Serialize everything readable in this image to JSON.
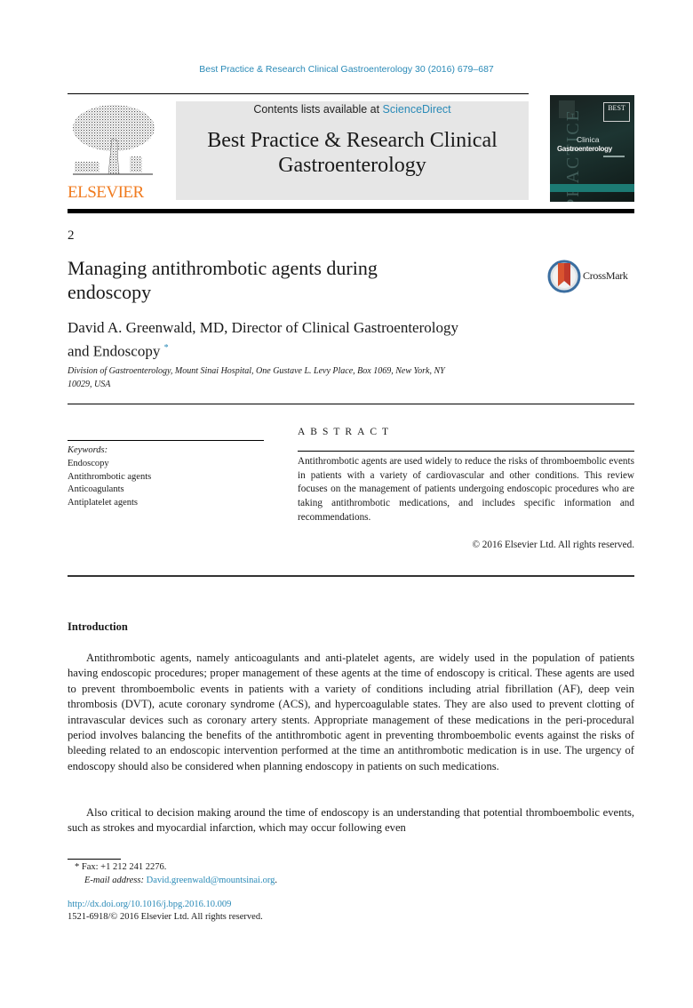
{
  "header": {
    "journal_reference": "Best Practice & Research Clinical Gastroenterology 30 (2016) 679–687",
    "contents_prefix": "Contents lists available at ",
    "contents_link": "ScienceDirect",
    "journal_title_line1": "Best Practice & Research Clinical",
    "journal_title_line2": "Gastroenterology",
    "publisher_logo_text": "ELSEVIER",
    "cover": {
      "badge_text": "BEST",
      "subtitle_line1": "Clinica",
      "subtitle_line2": "Gastroenterology",
      "vertical_text": "PRACTICE"
    },
    "colors": {
      "link": "#2a8ab7",
      "elsevier_orange": "#f07b1f",
      "masthead_bg": "#e6e6e6",
      "cover_stripe": "#1c7a73"
    }
  },
  "article": {
    "number": "2",
    "title_line1": "Managing antithrombotic agents during",
    "title_line2": "endoscopy",
    "crossmark_label": "CrossMark",
    "author_line1": "David A. Greenwald, MD, Director of Clinical Gastroenterology",
    "author_line2": "and Endoscopy",
    "author_marker": "*",
    "affiliation_line1": "Division of Gastroenterology, Mount Sinai Hospital, One Gustave L. Levy Place, Box 1069, New York, NY",
    "affiliation_line2": "10029, USA"
  },
  "keywords": {
    "label": "Keywords:",
    "items": [
      "Endoscopy",
      "Antithrombotic agents",
      "Anticoagulants",
      "Antiplatelet agents"
    ]
  },
  "abstract": {
    "heading": "ABSTRACT",
    "text": "Antithrombotic agents are used widely to reduce the risks of thromboembolic events in patients with a variety of cardiovascular and other conditions. This review focuses on the management of patients undergoing endoscopic procedures who are taking antithrombotic medications, and includes specific information and recommendations.",
    "copyright": "© 2016 Elsevier Ltd. All rights reserved."
  },
  "introduction": {
    "heading": "Introduction",
    "paragraphs": [
      "Antithrombotic agents, namely anticoagulants and anti-platelet agents, are widely used in the population of patients having endoscopic procedures; proper management of these agents at the time of endoscopy is critical. These agents are used to prevent thromboembolic events in patients with a variety of conditions including atrial fibrillation (AF), deep vein thrombosis (DVT), acute coronary syndrome (ACS), and hypercoagulable states. They are also used to prevent clotting of intravascular devices such as coronary artery stents. Appropriate management of these medications in the peri-procedural period involves balancing the benefits of the antithrombotic agent in preventing thromboembolic events against the risks of bleeding related to an endoscopic intervention performed at the time an antithrombotic medication is in use. The urgency of endoscopy should also be considered when planning endoscopy in patients on such medications.",
      "Also critical to decision making around the time of endoscopy is an understanding that potential thromboembolic events, such as strokes and myocardial infarction, which may occur following even"
    ]
  },
  "footnotes": {
    "fax": "* Fax: +1 212 241 2276.",
    "email_label": "E-mail address:",
    "email": "David.greenwald@mountsinai.org",
    "email_suffix": ".",
    "doi": "http://dx.doi.org/10.1016/j.bpg.2016.10.009",
    "issn": "1521-6918/© 2016 Elsevier Ltd. All rights reserved."
  }
}
